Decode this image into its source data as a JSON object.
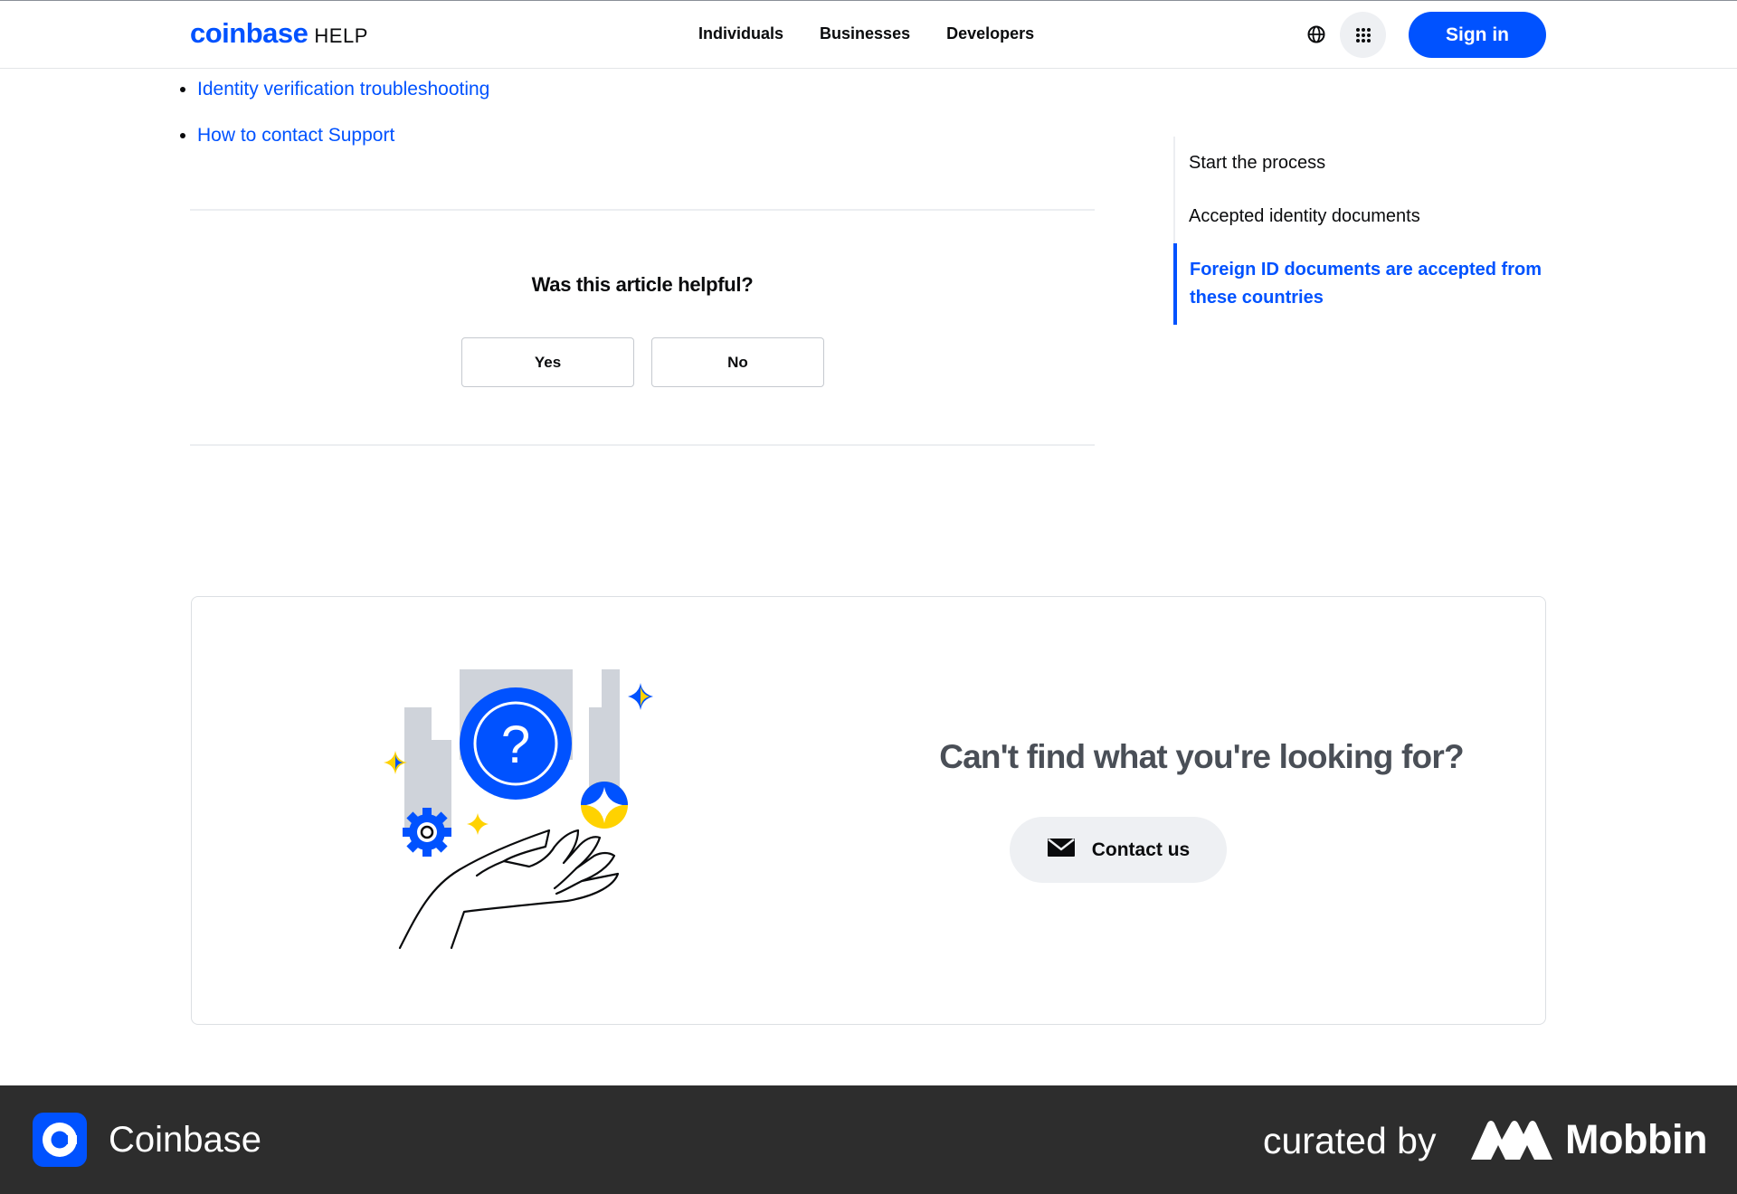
{
  "header": {
    "logo_word": "coinbase",
    "logo_suffix": "HELP",
    "nav": [
      "Individuals",
      "Businesses",
      "Developers"
    ],
    "sign_in": "Sign in"
  },
  "article": {
    "related_links": [
      "Identity verification troubleshooting",
      "How to contact Support"
    ]
  },
  "feedback": {
    "question": "Was this article helpful?",
    "yes": "Yes",
    "no": "No"
  },
  "toc": {
    "items": [
      {
        "label": "Start the process",
        "active": false
      },
      {
        "label": "Accepted identity documents",
        "active": false
      },
      {
        "label": "Foreign ID documents are accepted from these countries",
        "active": true
      }
    ]
  },
  "contact": {
    "heading": "Can't find what you're looking for?",
    "button": "Contact us"
  },
  "footer": {
    "app_name": "Coinbase",
    "curated_by": "curated by",
    "brand": "Mobbin"
  },
  "colors": {
    "brand_blue": "#0052ff",
    "footer_bg": "#2d2d2d",
    "accent_yellow": "#ffd200"
  }
}
